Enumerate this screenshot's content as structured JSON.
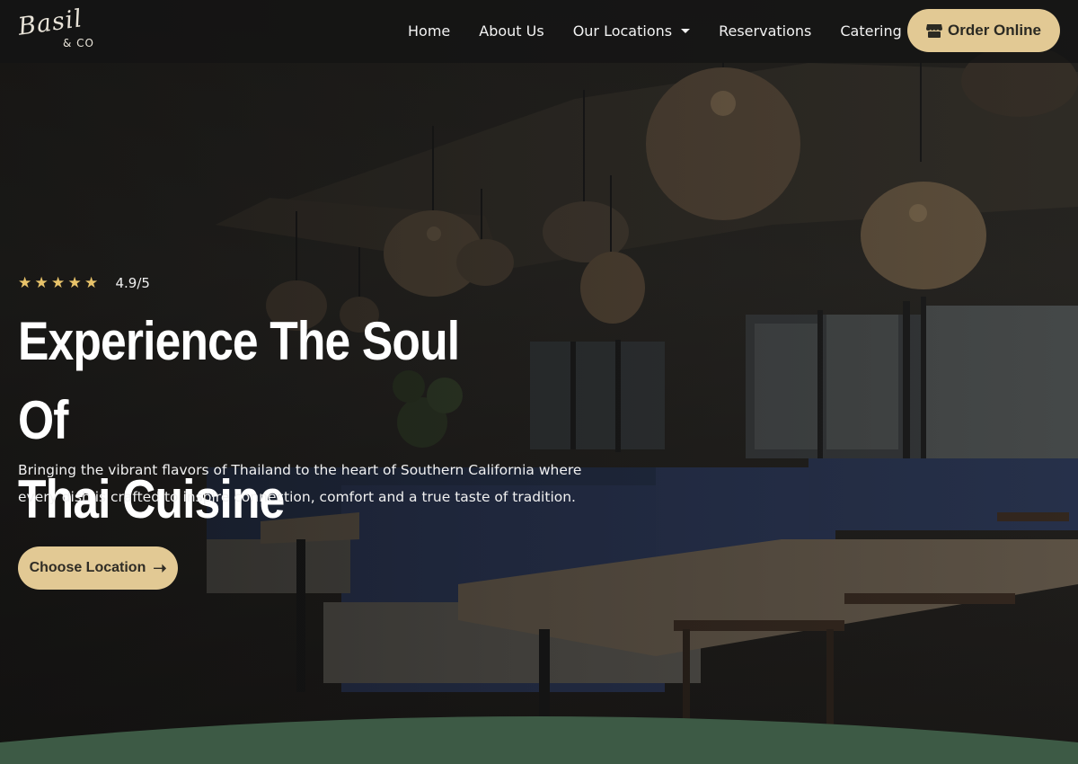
{
  "brand": {
    "logo_script": "Basil",
    "logo_sub": "& CO"
  },
  "nav": {
    "items": [
      {
        "label": "Home"
      },
      {
        "label": "About Us"
      },
      {
        "label": "Our Locations",
        "has_dropdown": true
      },
      {
        "label": "Reservations"
      },
      {
        "label": "Catering"
      }
    ],
    "order_button": {
      "label": "Order Online",
      "icon": "store-icon"
    }
  },
  "hero": {
    "rating": {
      "stars": 5,
      "text": "4.9/5"
    },
    "headline_line1": "Experience The Soul Of",
    "headline_line2": "Thai Cuisine",
    "subtext_line1": "Bringing the vibrant flavors of Thailand to the heart of Southern California where",
    "subtext_line2": "every dish is crafted to inspire connection, comfort and a true taste of tradition.",
    "cta": {
      "label": "Choose Location",
      "icon": "arrow-right-icon"
    }
  },
  "colors": {
    "accent": "#e2c994",
    "star": "#e8c36a",
    "section_green": "#3d5a45"
  }
}
